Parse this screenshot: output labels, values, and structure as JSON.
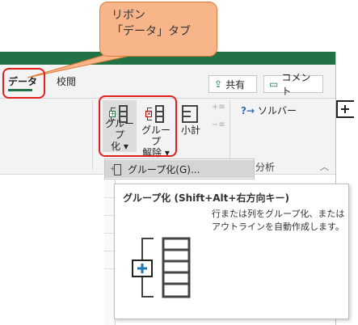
{
  "callout": {
    "line1": "リボン",
    "line2": "「データ」タブ"
  },
  "tabs": [
    {
      "label": "データ"
    },
    {
      "label": "校閲"
    }
  ],
  "share": {
    "icon": "share-icon",
    "label": "共有"
  },
  "comment": {
    "icon": "comment-icon",
    "label": "コメント"
  },
  "ribbon": {
    "group_button": {
      "line1": "グループ",
      "line2": "化 ▾"
    },
    "ungroup_button": {
      "line1": "グループ",
      "line2": "解除 ▾"
    },
    "subtotal_button": {
      "label": "小計"
    },
    "solver_label": "ソルバー",
    "analysis_group_label": "分析"
  },
  "menu": {
    "item_label": "グループ化(G)..."
  },
  "tooltip": {
    "title": "グループ化 (Shift+Alt+右方向キー)",
    "description": "行または列をグループ化、またはアウトラインを自動作成します。"
  },
  "colors": {
    "accent": "#217346",
    "highlight": "#e02020",
    "callout": "#f8b589"
  }
}
